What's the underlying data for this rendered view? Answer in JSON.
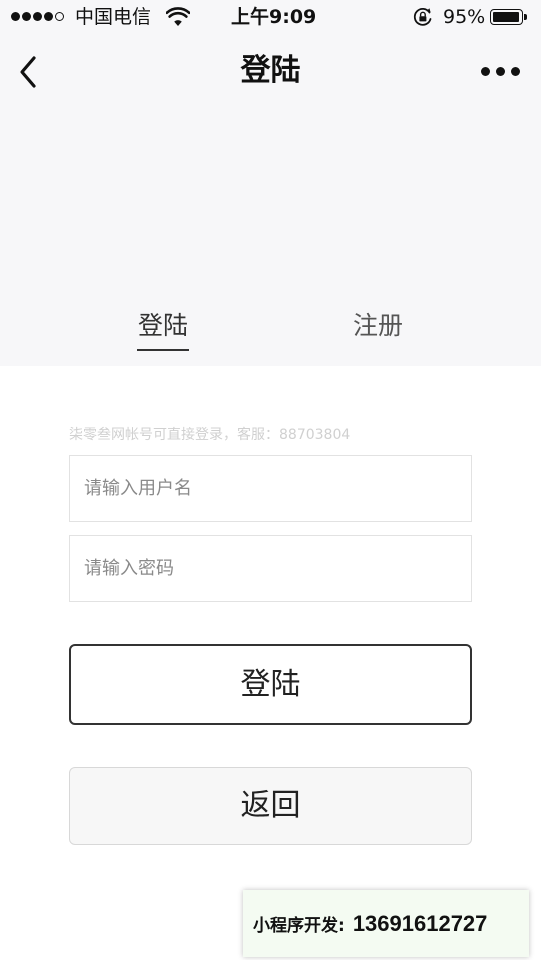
{
  "status_bar": {
    "carrier": "中国电信",
    "time": "上午9:09",
    "battery_percent": "95%",
    "signal_bars_filled": 4,
    "signal_bars_total": 5,
    "battery_level": 0.95,
    "icons": [
      "signal-dots-icon",
      "wifi-icon",
      "rotation-lock-icon",
      "battery-icon"
    ]
  },
  "nav": {
    "title": "登陆",
    "back_icon": "chevron-left-icon",
    "more_icon": "more-dots-icon"
  },
  "tabs": [
    {
      "label": "登陆",
      "active": true
    },
    {
      "label": "注册",
      "active": false
    }
  ],
  "form": {
    "hint": "柒零叁网帐号可直接登录，客服：88703804",
    "username": {
      "value": "",
      "placeholder": "请输入用户名"
    },
    "password": {
      "value": "",
      "placeholder": "请输入密码"
    },
    "login_label": "登陆",
    "back_label": "返回"
  },
  "watermark": {
    "label": "小程序开发:",
    "phone": "13691612727"
  },
  "colors": {
    "header_bg": "#f7f7f9",
    "page_bg": "#ffffff",
    "text_primary": "#111111",
    "hint_text": "#d0d0d0",
    "placeholder_text": "#8a8a8a",
    "watermark_bg": "#f4fbf2"
  }
}
